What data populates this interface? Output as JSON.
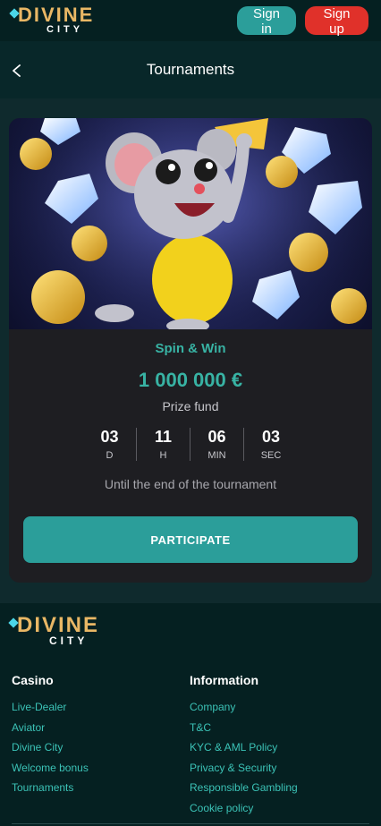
{
  "header": {
    "logo_top": "DIVINE",
    "logo_bottom": "CITY",
    "signin_label": "Sign in",
    "signup_label": "Sign up"
  },
  "titlebar": {
    "title": "Tournaments",
    "back_icon": "chevron-left-icon"
  },
  "tournament": {
    "name": "Spin & Win",
    "prize": "1 000 000 €",
    "prize_label": "Prize fund",
    "timer": [
      {
        "value": "03",
        "unit": "D"
      },
      {
        "value": "11",
        "unit": "H"
      },
      {
        "value": "06",
        "unit": "MIN"
      },
      {
        "value": "03",
        "unit": "SEC"
      }
    ],
    "until_text": "Until the end of the tournament",
    "participate_label": "PARTICIPATE"
  },
  "footer": {
    "logo_top": "DIVINE",
    "logo_bottom": "CITY",
    "casino": {
      "heading": "Casino",
      "links": [
        "Live-Dealer",
        "Aviator",
        "Divine City",
        "Welcome bonus",
        "Tournaments"
      ]
    },
    "information": {
      "heading": "Information",
      "links": [
        "Company",
        "T&C",
        "KYC & AML Policy",
        "Privacy & Security",
        "Responsible Gambling",
        "Cookie policy"
      ]
    }
  },
  "colors": {
    "accent": "#2b9e9a",
    "signup": "#e0312a",
    "link": "#3bc2b6",
    "logo_gold": "#e9b765"
  }
}
